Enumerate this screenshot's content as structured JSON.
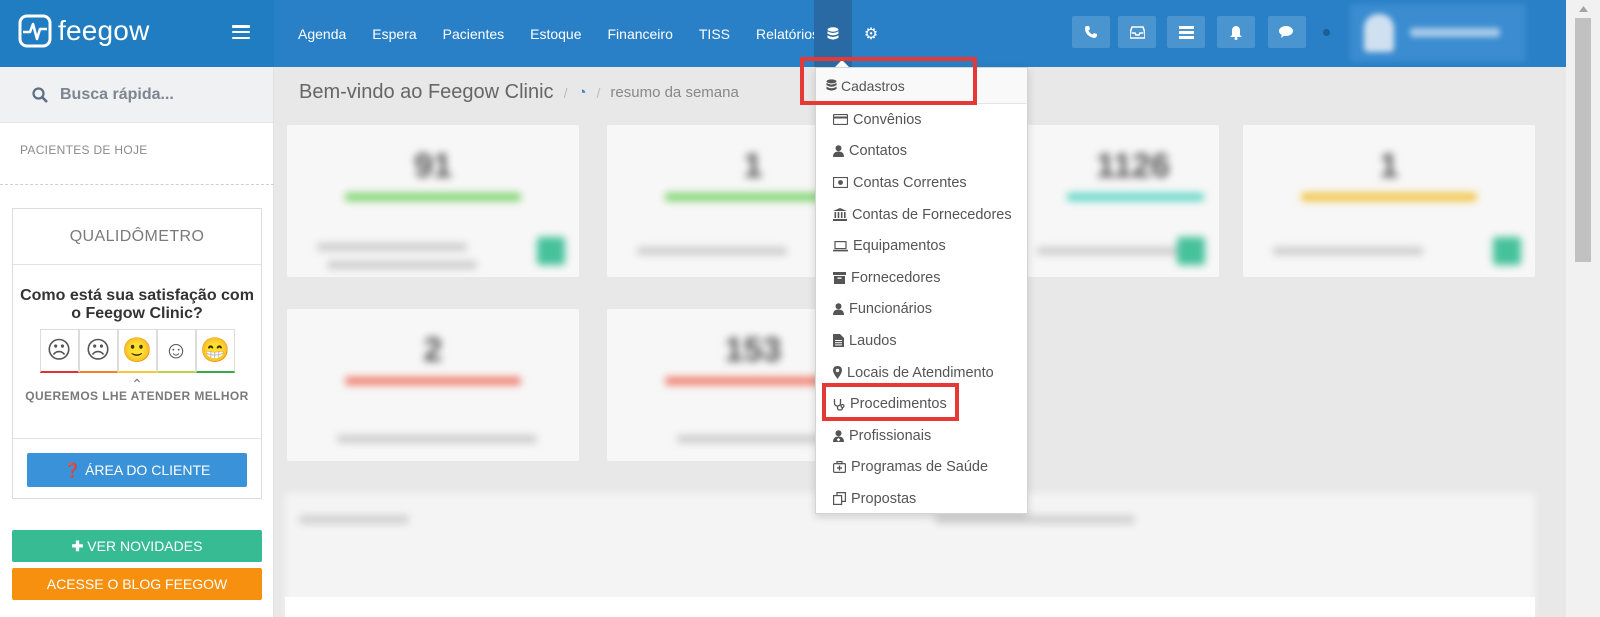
{
  "app": {
    "brand": "feegow"
  },
  "nav": {
    "items": [
      "Agenda",
      "Espera",
      "Pacientes",
      "Estoque",
      "Financeiro",
      "TISS",
      "Relatórios"
    ]
  },
  "sidebar": {
    "search_label": "Busca rápida...",
    "patients_today": "PACIENTES DE HOJE",
    "qualidometro": {
      "title": "QUALIDÔMETRO",
      "question": "Como está sua satisfação com o Feegow Clinic?",
      "faces": [
        "☹",
        "☹",
        "🙂",
        "☺",
        "😁"
      ],
      "subtitle": "QUEREMOS LHE ATENDER MELHOR",
      "client_area": "ÁREA DO CLIENTE"
    },
    "news_button": "VER NOVIDADES",
    "blog_button": "ACESSE O BLOG FEEGOW"
  },
  "breadcrumb": {
    "title": "Bem-vindo ao Feegow Clinic",
    "section": "resumo da semana"
  },
  "cards": [
    {
      "value": "91",
      "color": "#7dd46c"
    },
    {
      "value": "1",
      "color": "#7dd46c"
    },
    {
      "value": "1126",
      "color": "#5fd6c6"
    },
    {
      "value": "1",
      "color": "#f2c33c"
    },
    {
      "value": "2",
      "color": "#ef7b6a"
    },
    {
      "value": "153",
      "color": "#ef7b6a"
    }
  ],
  "dropdown": {
    "header": "Cadastros",
    "items": [
      {
        "label": "Convênios",
        "icon": "credit-card-icon"
      },
      {
        "label": "Contatos",
        "icon": "user-icon"
      },
      {
        "label": "Contas Correntes",
        "icon": "money-icon"
      },
      {
        "label": "Contas de Fornecedores",
        "icon": "bank-icon"
      },
      {
        "label": "Equipamentos",
        "icon": "laptop-icon"
      },
      {
        "label": "Fornecedores",
        "icon": "archive-icon"
      },
      {
        "label": "Funcionários",
        "icon": "user-icon"
      },
      {
        "label": "Laudos",
        "icon": "file-text-icon"
      },
      {
        "label": "Locais de Atendimento",
        "icon": "map-marker-icon"
      },
      {
        "label": "Procedimentos",
        "icon": "stethoscope-icon"
      },
      {
        "label": "Profissionais",
        "icon": "user-md-icon"
      },
      {
        "label": "Programas de Saúde",
        "icon": "medkit-icon"
      },
      {
        "label": "Propostas",
        "icon": "copy-icon"
      }
    ]
  },
  "colors": {
    "topbar": "#2a80c6",
    "highlight": "#e53935",
    "green": "#36bb93",
    "orange": "#f7900f",
    "blue_button": "#3a93d8"
  }
}
